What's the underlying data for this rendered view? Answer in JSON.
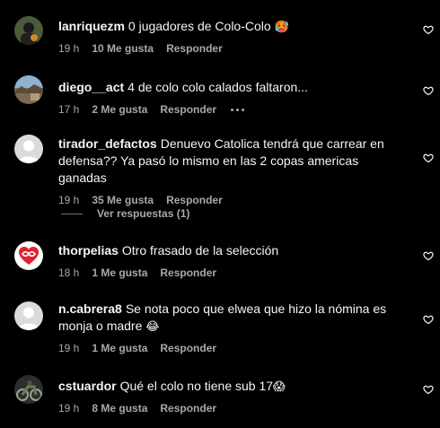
{
  "comments": [
    {
      "username": "lanriquezm",
      "text": "0 jugadores de Colo-Colo",
      "emoji": "🥵",
      "time": "19 h",
      "likes": "10 Me gusta",
      "reply": "Responder",
      "avatar": "photo-dark-person"
    },
    {
      "username": "diego__act",
      "text": "4 de colo colo calados faltaron...",
      "emoji": "",
      "time": "17 h",
      "likes": "2 Me gusta",
      "reply": "Responder",
      "avatar": "photo-landscape"
    },
    {
      "username": "tirador_defactos",
      "text": "Denuevo Catolica tendrá que carrear en defensa?? Ya pasó lo mismo en las 2 copas americas ganadas",
      "emoji": "",
      "time": "19 h",
      "likes": "35 Me gusta",
      "reply": "Responder",
      "avatar": "default-avatar"
    },
    {
      "username": "thorpelias",
      "text": "Otro frasado de la selección",
      "emoji": "",
      "time": "18 h",
      "likes": "1 Me gusta",
      "reply": "Responder",
      "avatar": "red-logo"
    },
    {
      "username": "n.cabrera8",
      "text": "Se nota poco que elwea que hizo la nómina es monja o madre",
      "emoji": "😂",
      "time": "19 h",
      "likes": "1 Me gusta",
      "reply": "Responder",
      "avatar": "default-avatar"
    },
    {
      "username": "cstuardor",
      "text": "Qué el colo no tiene sub 17",
      "emoji": "😱",
      "time": "19 h",
      "likes": "8 Me gusta",
      "reply": "Responder",
      "avatar": "photo-motorbike"
    }
  ],
  "view_replies": "Ver respuestas (1)",
  "colors": {
    "background": "#000000",
    "text": "#f5f5f5",
    "secondary": "#a8a8a8",
    "logo_red": "#e0242f"
  },
  "icons": {
    "like": "heart-outline-icon",
    "more": "ellipsis-icon"
  }
}
